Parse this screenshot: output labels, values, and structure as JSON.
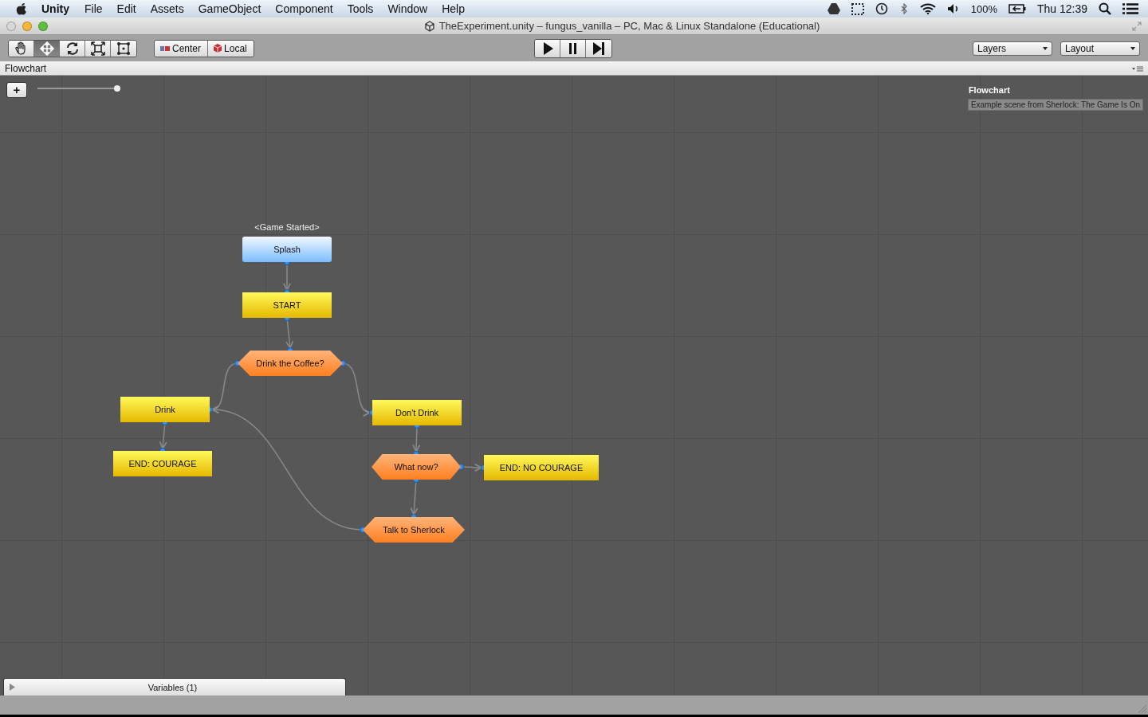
{
  "menu_bar": {
    "app": "Unity",
    "items": [
      "File",
      "Edit",
      "Assets",
      "GameObject",
      "Component",
      "Tools",
      "Window",
      "Help"
    ],
    "battery": "100%",
    "clock": "Thu 12:39"
  },
  "window": {
    "title": "TheExperiment.unity – fungus_vanilla – PC, Mac & Linux Standalone (Educational)"
  },
  "toolbar": {
    "tools": [
      {
        "kind": "hand",
        "selected": false
      },
      {
        "kind": "move",
        "selected": true
      },
      {
        "kind": "rotate",
        "selected": false
      },
      {
        "kind": "scale",
        "selected": false
      },
      {
        "kind": "rect",
        "selected": false
      }
    ],
    "pivot": [
      {
        "kind": "pivot",
        "label": "Center"
      },
      {
        "kind": "space",
        "label": "Local"
      }
    ],
    "playback": [
      {
        "kind": "play",
        "on": false
      },
      {
        "kind": "pause",
        "on": false
      },
      {
        "kind": "step",
        "on": false
      }
    ],
    "dropdowns": [
      "Layers",
      "Layout"
    ]
  },
  "tab": {
    "label": "Flowchart"
  },
  "flowchart": {
    "zoom": {
      "level": 1.0
    },
    "title": "Flowchart",
    "description": "Example scene from Sherlock: The Game Is On",
    "nodes": [
      {
        "kind": "event",
        "label": "Splash",
        "event": "<Game Started>"
      },
      {
        "kind": "block",
        "label": "START"
      },
      {
        "kind": "branch",
        "label": "Drink the Coffee?"
      },
      {
        "kind": "block",
        "label": "Drink"
      },
      {
        "kind": "block",
        "label": "END: COURAGE"
      },
      {
        "kind": "block",
        "label": "Don't Drink"
      },
      {
        "kind": "branch",
        "label": "What now?"
      },
      {
        "kind": "block",
        "label": "END: NO COURAGE"
      },
      {
        "kind": "branch",
        "label": "Talk to Sherlock"
      }
    ],
    "add_button": "+",
    "variables": {
      "label": "Variables (1)",
      "expanded": false
    }
  }
}
